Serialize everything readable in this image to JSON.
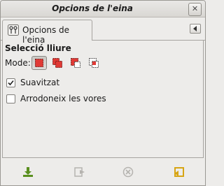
{
  "window": {
    "title": "Opcions de l'eina",
    "close_glyph": "✕"
  },
  "tab": {
    "label": "Opcions de l'eina",
    "icon": "tool-options-icon",
    "menu_icon": "tab-menu-arrow-icon"
  },
  "section": {
    "title": "Selecció lliure"
  },
  "mode": {
    "label": "Mode:",
    "options": [
      {
        "name": "replace-selection-icon",
        "active": true
      },
      {
        "name": "add-to-selection-icon",
        "active": false
      },
      {
        "name": "subtract-from-selection-icon",
        "active": false
      },
      {
        "name": "intersect-selection-icon",
        "active": false
      }
    ]
  },
  "options": {
    "antialias": {
      "label": "Suavitzat",
      "checked": true
    },
    "feather": {
      "label": "Arrodoneix les vores",
      "checked": false
    }
  },
  "bottom_buttons": [
    {
      "name": "save-options-icon",
      "enabled": true,
      "color": "#5a8f1f"
    },
    {
      "name": "restore-options-icon",
      "enabled": false,
      "color": "#b5b3af"
    },
    {
      "name": "delete-options-icon",
      "enabled": false,
      "color": "#b5b3af"
    },
    {
      "name": "reset-options-icon",
      "enabled": true,
      "color": "#d7a514"
    }
  ],
  "colors": {
    "selection_red": "#e03a35"
  }
}
